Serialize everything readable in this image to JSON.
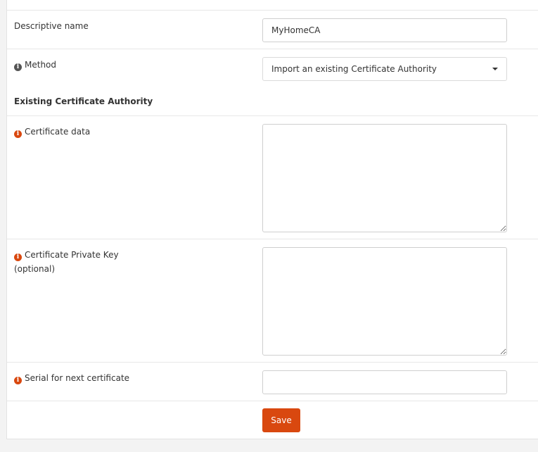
{
  "form": {
    "descriptive_name": {
      "label": "Descriptive name",
      "value": "MyHomeCA"
    },
    "method": {
      "label": "Method",
      "selected": "Import an existing Certificate Authority"
    },
    "section_title": "Existing Certificate Authority",
    "certificate_data": {
      "label": "Certificate data",
      "value": ""
    },
    "private_key": {
      "label_line1": "Certificate Private Key",
      "label_line2": "(optional)",
      "value": ""
    },
    "serial": {
      "label": "Serial for next certificate",
      "value": ""
    },
    "save_label": "Save"
  },
  "icons": {
    "method_info": "info-circle-icon",
    "field_info": "info-circle-icon"
  },
  "colors": {
    "accent": "#d9480f",
    "info_gray": "#555555",
    "background": "#f3f3f3"
  }
}
